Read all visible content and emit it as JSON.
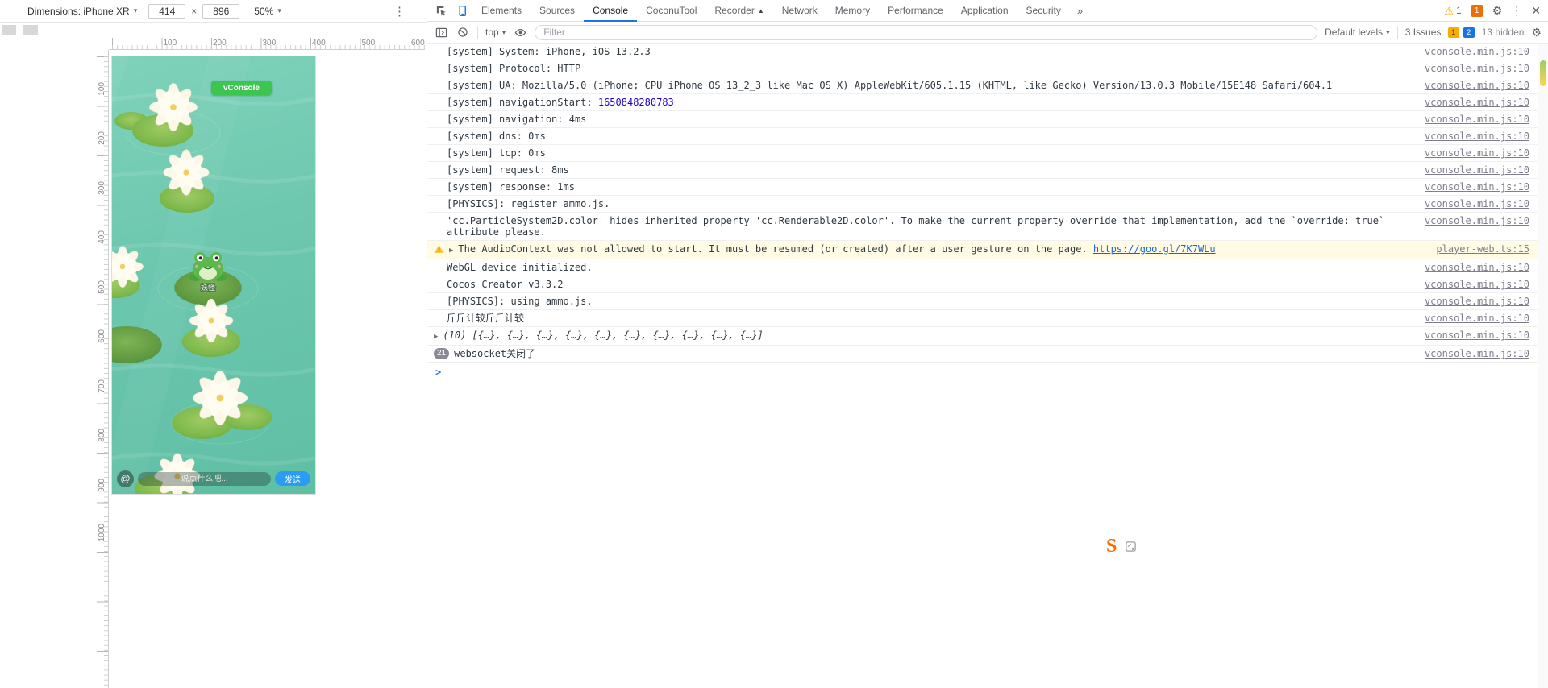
{
  "colors": {
    "accent_blue": "#1a73e8",
    "vconsole_green": "#3dc550",
    "send_blue": "#2b9cf4",
    "warning_row_bg": "#fffbe5",
    "pond_teal": "#6cc7ae",
    "error_badge_orange": "#e8710a",
    "number_blue": "#1c00cf"
  },
  "icons": {
    "caret": "▾",
    "kebab": "⋮",
    "close": "✕",
    "more_tabs": "»",
    "expand": "▶",
    "prompt_chevron": ">",
    "gear": "⚙",
    "warning": "⚠",
    "at": "@",
    "s_logo": "S"
  },
  "device_toolbar": {
    "dimensions_label": "Dimensions: iPhone XR",
    "width": "414",
    "times": "×",
    "height": "896",
    "zoom": "50%"
  },
  "rulers": {
    "h": [
      "100",
      "200",
      "300",
      "400",
      "500",
      "600"
    ],
    "v": [
      "100",
      "200",
      "300",
      "400",
      "500",
      "600",
      "700",
      "800",
      "900",
      "1000"
    ]
  },
  "device": {
    "vconsole_label": "vConsole",
    "frog_name": "妖怪",
    "chat_placeholder": "说点什么吧...",
    "send_label": "发送"
  },
  "devtools": {
    "tabs": [
      "Elements",
      "Sources",
      "Console",
      "CoconuTool",
      "Recorder",
      "Network",
      "Memory",
      "Performance",
      "Application",
      "Security"
    ],
    "badges": {
      "warnings": "1",
      "errors": "1"
    },
    "toolbar": {
      "context": "top",
      "filter_placeholder": "Filter",
      "levels": "Default levels",
      "issues_label": "3 Issues:",
      "issues_warn": "1",
      "issues_info": "2",
      "hidden": "13 hidden"
    },
    "prompt": ">",
    "messages": [
      {
        "text": "[system] System: iPhone, iOS 13.2.3",
        "source": "vconsole.min.js:10"
      },
      {
        "text": "[system] Protocol: HTTP",
        "source": "vconsole.min.js:10"
      },
      {
        "text": "[system] UA: Mozilla/5.0 (iPhone; CPU iPhone OS 13_2_3 like Mac OS X) AppleWebKit/605.1.15 (KHTML, like Gecko) Version/13.0.3 Mobile/15E148 Safari/604.1",
        "source": "vconsole.min.js:10"
      },
      {
        "prefix": "[system] navigationStart: ",
        "number": "1650848280783",
        "source": "vconsole.min.js:10"
      },
      {
        "text": "[system] navigation: 4ms",
        "source": "vconsole.min.js:10"
      },
      {
        "text": "[system] dns: 0ms",
        "source": "vconsole.min.js:10"
      },
      {
        "text": "[system] tcp: 0ms",
        "source": "vconsole.min.js:10"
      },
      {
        "text": "[system] request: 8ms",
        "source": "vconsole.min.js:10"
      },
      {
        "text": "[system] response: 1ms",
        "source": "vconsole.min.js:10"
      },
      {
        "text": "[PHYSICS]: register ammo.js.",
        "source": "vconsole.min.js:10"
      },
      {
        "text": "'cc.ParticleSystem2D.color' hides inherited property 'cc.Renderable2D.color'. To make the current property override that implementation, add the `override: true` attribute please.",
        "source": "vconsole.min.js:10"
      },
      {
        "text": "The AudioContext was not allowed to start. It must be resumed (or created) after a user gesture on the page. ",
        "link": "https://goo.gl/7K7WLu",
        "source": "player-web.ts:15"
      },
      {
        "text": "WebGL device initialized.",
        "source": "vconsole.min.js:10"
      },
      {
        "text": "Cocos Creator v3.3.2",
        "source": "vconsole.min.js:10"
      },
      {
        "text": "[PHYSICS]: using ammo.js.",
        "source": "vconsole.min.js:10"
      },
      {
        "text": "斤斤计较斤斤计较",
        "source": "vconsole.min.js:10"
      },
      {
        "count": "(10)",
        "body": " [{…}, {…}, {…}, {…}, {…}, {…}, {…}, {…}, {…}, {…}]",
        "source": "vconsole.min.js:10"
      },
      {
        "badge": "21",
        "text": "websocket关闭了",
        "source": "vconsole.min.js:10"
      }
    ]
  }
}
